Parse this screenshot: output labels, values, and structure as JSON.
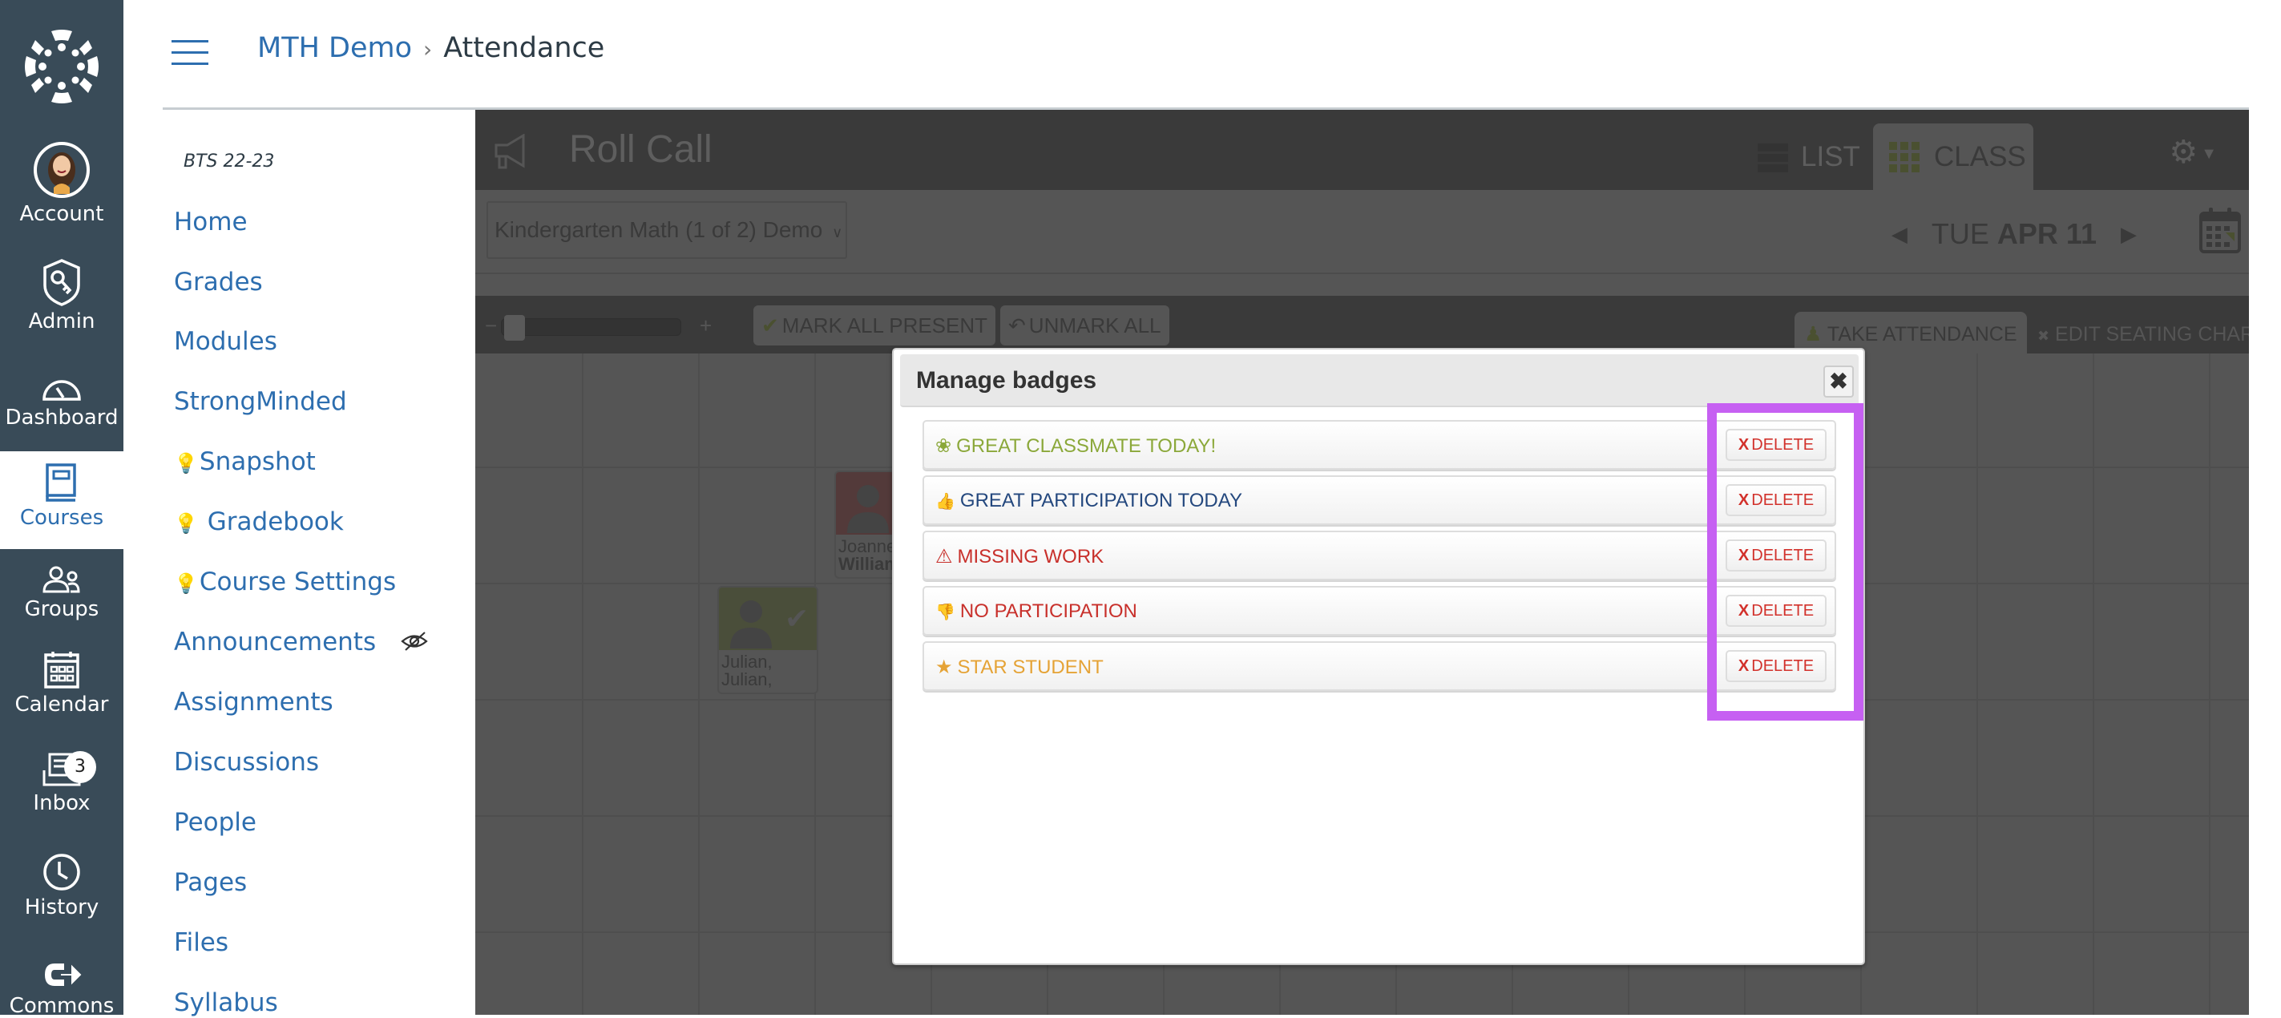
{
  "global_nav": {
    "items": [
      {
        "label": "Account",
        "icon": "avatar"
      },
      {
        "label": "Admin",
        "icon": "shield-key-icon"
      },
      {
        "label": "Dashboard",
        "icon": "speedometer-icon"
      },
      {
        "label": "Courses",
        "icon": "book-icon",
        "active": true
      },
      {
        "label": "Groups",
        "icon": "groups-icon"
      },
      {
        "label": "Calendar",
        "icon": "calendar-icon"
      },
      {
        "label": "Inbox",
        "icon": "inbox-icon",
        "count": "3"
      },
      {
        "label": "History",
        "icon": "clock-icon"
      },
      {
        "label": "Commons",
        "icon": "commons-icon"
      }
    ]
  },
  "header": {
    "breadcrumb": [
      "MTH Demo",
      "Attendance"
    ]
  },
  "course_nav": {
    "term": "BTS 22-23",
    "items": [
      {
        "label": "Home"
      },
      {
        "label": "Grades"
      },
      {
        "label": "Modules"
      },
      {
        "label": "StrongMinded"
      },
      {
        "label": "Snapshot",
        "bulb": true
      },
      {
        "label": "Gradebook",
        "bulb": true
      },
      {
        "label": "Course Settings",
        "bulb": true
      },
      {
        "label": "Announcements",
        "hidden_icon": true
      },
      {
        "label": "Assignments"
      },
      {
        "label": "Discussions"
      },
      {
        "label": "People"
      },
      {
        "label": "Pages"
      },
      {
        "label": "Files"
      },
      {
        "label": "Syllabus"
      }
    ]
  },
  "roll_call": {
    "title": "Roll Call",
    "tabs": [
      {
        "label": "LIST"
      },
      {
        "label": "CLASS",
        "active": true
      }
    ],
    "section_select": "Kindergarten Math (1 of 2) Demo",
    "date_weekday": "TUE",
    "date_rest": "APR 11",
    "toolbar": {
      "mark_all_present": "MARK ALL PRESENT",
      "unmark_all": "UNMARK ALL",
      "take_attendance": "TAKE ATTENDANCE",
      "edit_seating_chart": "EDIT SEATING CHART",
      "zoom_minus": "−",
      "zoom_plus": "+"
    },
    "students": [
      {
        "line1": "Joanne",
        "line2": "William",
        "status": "absent"
      },
      {
        "line1": "Julian,",
        "line2": "Julian,",
        "status": "present"
      }
    ]
  },
  "modal": {
    "title": "Manage badges",
    "close_label": "✖",
    "delete_x": "X",
    "delete_label": "DELETE",
    "badges": [
      {
        "label": "GREAT CLASSMATE TODAY!",
        "icon": "award-ribbon-icon",
        "glyph": "❀",
        "color": "#8BA83A"
      },
      {
        "label": "GREAT PARTICIPATION TODAY",
        "icon": "thumbs-up-icon",
        "glyph": "👍",
        "color": "#24487E"
      },
      {
        "label": "MISSING WORK",
        "icon": "warning-icon",
        "glyph": "⚠",
        "color": "#C8302B"
      },
      {
        "label": "NO PARTICIPATION",
        "icon": "thumbs-down-icon",
        "glyph": "👎",
        "color": "#C8302B"
      },
      {
        "label": "STAR STUDENT",
        "icon": "star-icon",
        "glyph": "★",
        "color": "#E5A336"
      }
    ]
  },
  "colors": {
    "highlight": "#C660F2",
    "nav_bg": "#394B58",
    "link": "#2D6EAF",
    "delete": "#D2312B"
  }
}
